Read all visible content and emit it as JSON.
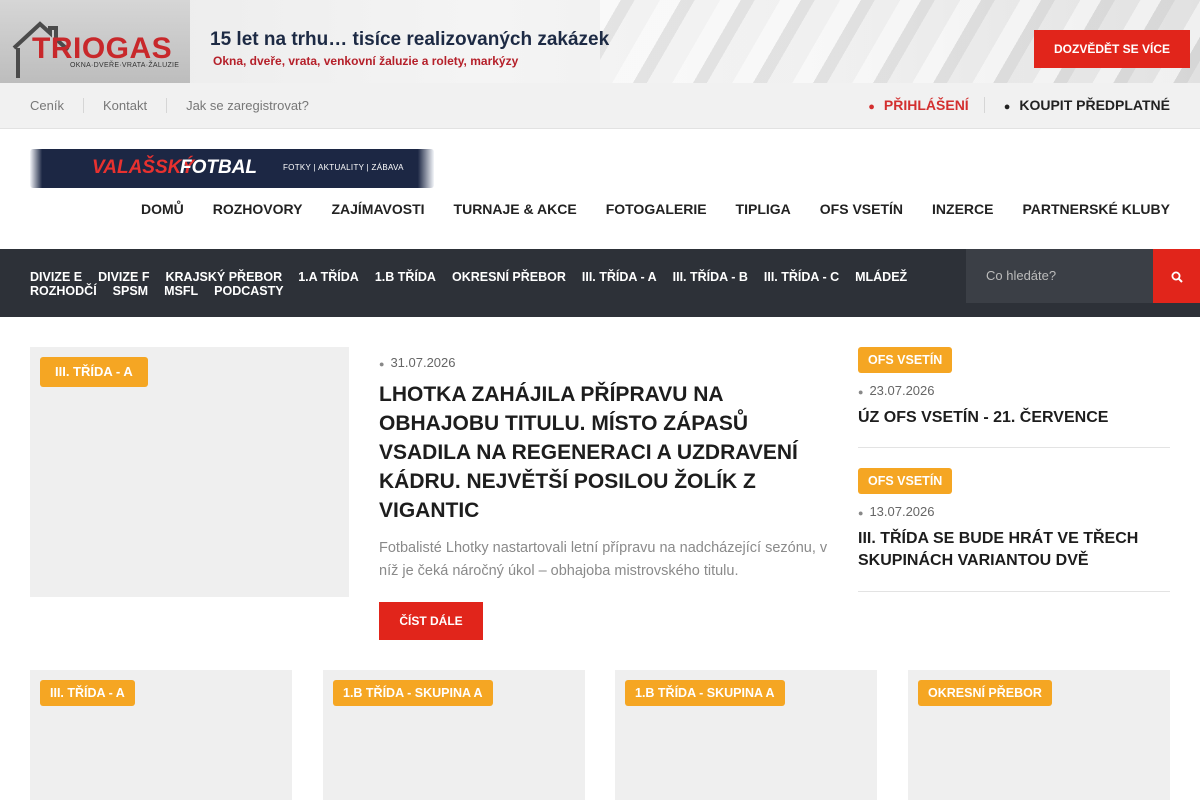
{
  "banner": {
    "logo": "TRIOGAS",
    "logo_sub": "OKNA·DVEŘE·VRATA·ŽALUZIE",
    "headline": "15 let na trhu… tisíce realizovaných zakázek",
    "subline": "Okna, dveře, vrata, venkovní žaluzie a rolety, markýzy",
    "cta": "DOZVĚDĚT SE VÍCE"
  },
  "utility": {
    "links": [
      "Ceník",
      "Kontakt",
      "Jak se zaregistrovat?"
    ],
    "login": "PŘIHLÁŠENÍ",
    "buy": "KOUPIT PŘEDPLATNÉ",
    "login_icon": "user-icon",
    "buy_icon": "cart-icon"
  },
  "site": {
    "name_part1": "VALAŠSKÝ",
    "name_part2": "FOTBAL",
    "tagline": "FOTKY | AKTUALITY | ZÁBAVA"
  },
  "mainnav": [
    "DOMŮ",
    "ROZHOVORY",
    "ZAJÍMAVOSTI",
    "TURNAJE & AKCE",
    "FOTOGALERIE",
    "TIPLIGA",
    "OFS VSETÍN",
    "INZERCE",
    "PARTNERSKÉ KLUBY"
  ],
  "catnav": {
    "items": [
      "DIVIZE E",
      "DIVIZE F",
      "KRAJSKÝ PŘEBOR",
      "1.A TŘÍDA",
      "1.B TŘÍDA",
      "OKRESNÍ PŘEBOR",
      "III. TŘÍDA - A",
      "III. TŘÍDA - B",
      "III. TŘÍDA - C",
      "MLÁDEŽ",
      "ROZHODČÍ",
      "SPSM",
      "MSFL",
      "PODCASTY"
    ],
    "search_placeholder": "Co hledáte?",
    "search_icon": "search-icon"
  },
  "featured": {
    "category": "III. TŘÍDA - A",
    "date": "31.07.2026",
    "title": "LHOTKA ZAHÁJILA PŘÍPRAVU NA OBHAJOBU TITULU. MÍSTO ZÁPASŮ VSADILA NA REGENERACI A UZDRAVENÍ KÁDRU. NEJVĚTŠÍ POSILOU ŽOLÍK Z VIGANTIC",
    "excerpt": "Fotbalisté Lhotky nastartovali letní přípravu na nadcházející sezónu, v níž je čeká náročný úkol – obhajoba mistrovského titulu.",
    "read_more": "ČÍST DÁLE"
  },
  "sidebar": [
    {
      "category": "OFS VSETÍN",
      "date": "23.07.2026",
      "title": "ÚZ OFS VSETÍN - 21. ČERVENCE"
    },
    {
      "category": "OFS VSETÍN",
      "date": "13.07.2026",
      "title": "III. TŘÍDA SE BUDE HRÁT VE TŘECH SKUPINÁCH VARIANTOU DVĚ"
    }
  ],
  "cards": [
    {
      "category": "III. TŘÍDA - A"
    },
    {
      "category": "1.B TŘÍDA - SKUPINA A"
    },
    {
      "category": "1.B TŘÍDA - SKUPINA A"
    },
    {
      "category": "OKRESNÍ PŘEBOR"
    }
  ],
  "colors": {
    "accent_red": "#e1251b",
    "badge_orange": "#f5a623",
    "dark_nav": "#2d3138"
  }
}
